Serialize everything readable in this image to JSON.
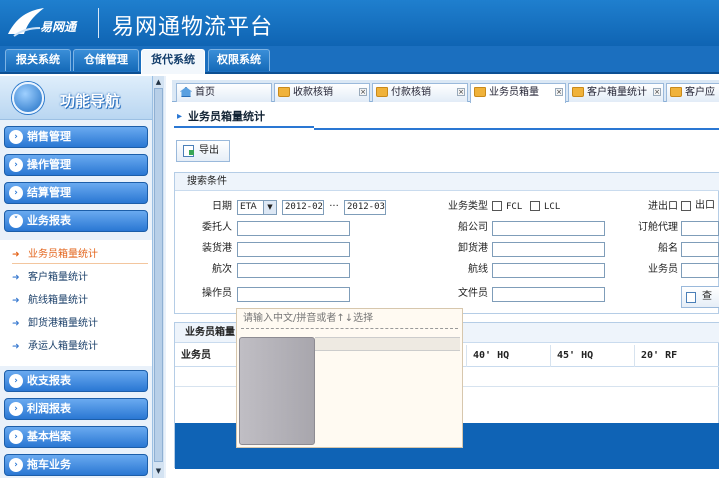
{
  "header": {
    "logo_text": "易网通",
    "app_title": "易网通物流平台"
  },
  "topnav": {
    "tabs": [
      {
        "label": "报关系统"
      },
      {
        "label": "仓储管理"
      },
      {
        "label": "货代系统",
        "active": true
      },
      {
        "label": "权限系统"
      }
    ]
  },
  "sidebar": {
    "title": "功能导航",
    "groups_top": [
      {
        "label": "销售管理"
      },
      {
        "label": "操作管理"
      },
      {
        "label": "结算管理"
      },
      {
        "label": "业务报表",
        "expanded": true
      }
    ],
    "items": [
      {
        "label": "业务员箱量统计",
        "active": true
      },
      {
        "label": "客户箱量统计"
      },
      {
        "label": "航线箱量统计"
      },
      {
        "label": "卸货港箱量统计"
      },
      {
        "label": "承运人箱量统计"
      }
    ],
    "groups_bottom": [
      {
        "label": "收支报表"
      },
      {
        "label": "利润报表"
      },
      {
        "label": "基本档案"
      },
      {
        "label": "拖车业务"
      }
    ]
  },
  "page_tabs": [
    {
      "label": "首页",
      "icon": "home-icon"
    },
    {
      "label": "收款核销",
      "icon": "folder-icon"
    },
    {
      "label": "付款核销",
      "icon": "folder-icon"
    },
    {
      "label": "业务员箱量",
      "icon": "folder-icon",
      "active": true
    },
    {
      "label": "客户箱量统计",
      "icon": "folder-icon"
    },
    {
      "label": "客户应",
      "icon": "folder-icon"
    }
  ],
  "page": {
    "title": "业务员箱量统计",
    "export_label": "导出"
  },
  "search": {
    "section_title": "搜索条件",
    "date_label": "日期",
    "date_type": "ETA",
    "date_from": "2012-02",
    "date_sep": "···",
    "date_to": "2012-03",
    "biz_type_label": "业务类型",
    "fcl_label": "FCL",
    "lcl_label": "LCL",
    "io_label": "进出口",
    "export_opt_label": "出口",
    "client_label": "委托人",
    "carrier_label": "船公司",
    "booking_agent_label": "订舱代理",
    "pol_label": "装货港",
    "pod_label": "卸货港",
    "vessel_label": "船名",
    "voyage_label": "航次",
    "route_label": "航线",
    "salesman_label": "业务员",
    "operator_label": "操作员",
    "doc_clerk_label": "文件员",
    "query_label": "查询"
  },
  "grid": {
    "title": "业务员箱量",
    "columns": [
      "业务员",
      "",
      "",
      "40' HQ",
      "45' HQ",
      "20' RF"
    ]
  },
  "popup": {
    "hint": "请输入中文/拼音或者↑↓选择"
  }
}
